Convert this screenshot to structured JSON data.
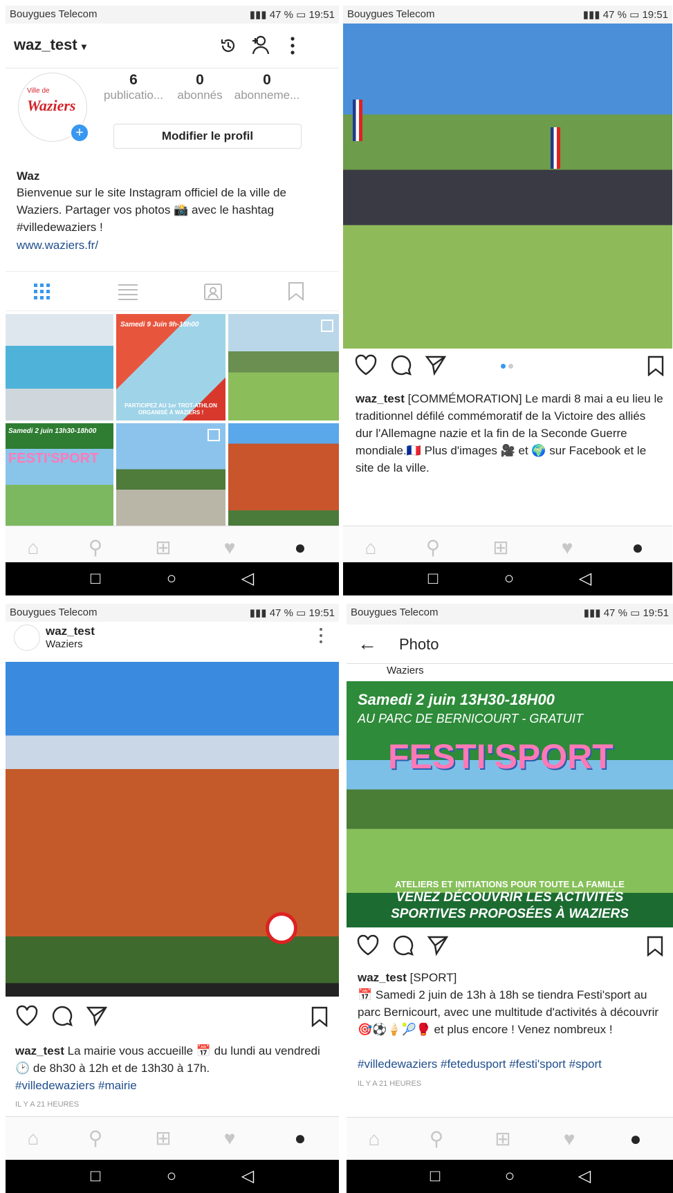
{
  "status": {
    "carrier": "Bouygues Telecom",
    "battery": "47 %",
    "time": "19:51"
  },
  "profile": {
    "username": "waz_test",
    "stats": [
      {
        "count": "6",
        "label": "publicatio..."
      },
      {
        "count": "0",
        "label": "abonnés"
      },
      {
        "count": "0",
        "label": "abonneme..."
      }
    ],
    "edit_button": "Modifier le profil",
    "avatar_text": "Waziers",
    "avatar_sub": "Ville de",
    "name": "Waz",
    "bio": "Bienvenue sur le site Instagram officiel de la ville de Waziers. Partager vos photos 📸 avec le hashtag #villedewaziers !",
    "website": "www.waziers.fr/",
    "grid_banner_1": "Samedi 9 Juin 9h-18h00",
    "grid_banner_2": "PARTICIPEZ AU 1er TROT-ATHLON ORGANISÉ À WAZIERS !",
    "grid_festi": "FESTI'SPORT",
    "grid_festi_date": "Samedi 2 juin 13h30-18h00"
  },
  "post1": {
    "username": "waz_test",
    "caption": "[COMMÉMORATION] Le mardi 8 mai a eu lieu le traditionnel défilé commémoratif de la Victoire des alliés dur l'Allemagne nazie et la fin de la Seconde Guerre mondiale.🇫🇷 Plus d'images 🎥 et 🌍 sur Facebook et le site de la ville."
  },
  "post2": {
    "username": "waz_test",
    "location": "Waziers",
    "caption": "La mairie vous accueille 📅 du lundi au vendredi 🕑 de 8h30 à 12h et de 13h30 à 17h.",
    "hashtags": "#villedewaziers #mairie",
    "time_ago": "IL Y A 21 HEURES"
  },
  "post3": {
    "header": "Photo",
    "username": "waz_test",
    "location": "Waziers",
    "banner_date": "Samedi 2 juin 13H30-18H00",
    "banner_place": "AU PARC DE BERNICOURT - GRATUIT",
    "banner_title": "FESTI'SPORT",
    "banner_sub1": "ATELIERS ET INITIATIONS POUR TOUTE LA FAMILLE",
    "banner_sub2": "VENEZ DÉCOUVRIR LES ACTIVITÉS",
    "banner_sub3": "SPORTIVES PROPOSÉES À WAZIERS",
    "caption_tag": "[SPORT]",
    "caption": "📅 Samedi 2 juin de 13h à 18h se tiendra Festi'sport au parc Bernicourt, avec une multitude d'activités à découvrir 🎯⚽🍦🎾🥊 et plus encore ! Venez nombreux !",
    "hashtags": "#villedewaziers #fetedusport #festi'sport #sport",
    "time_ago": "IL Y A 21 HEURES"
  }
}
